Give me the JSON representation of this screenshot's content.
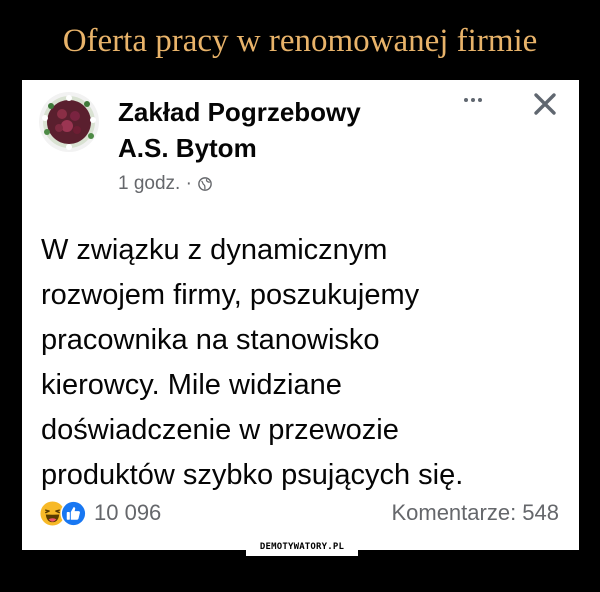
{
  "meme": {
    "headline": "Oferta pracy w renomowanej firmie",
    "headline_color": "#e8b36a",
    "watermark": "DEMOTYWATORY.PL"
  },
  "post": {
    "author_lines": [
      "Zakład Pogrzebowy",
      "A.S. Bytom"
    ],
    "time": "1 godz. ·",
    "visibility_icon": "globe-icon",
    "more_icon": "more-options-icon",
    "close_icon": "close-icon",
    "text_lines": [
      "W związku z dynamicznym",
      "rozwojem firmy, poszukujemy",
      "pracownika na stanowisko",
      "kierowcy. Mile widziane",
      "doświadczenie w przewozie",
      "produktów szybko psujących się."
    ],
    "reactions": {
      "icons": [
        "haha-icon",
        "like-icon"
      ],
      "count": "10 096"
    },
    "comments_label": "Komentarze: 548"
  },
  "colors": {
    "background": "#000000",
    "card": "#ffffff",
    "text_primary": "#050505",
    "text_secondary": "#65676b",
    "like_blue": "#1877f2",
    "haha_yellow": "#f7b928"
  }
}
